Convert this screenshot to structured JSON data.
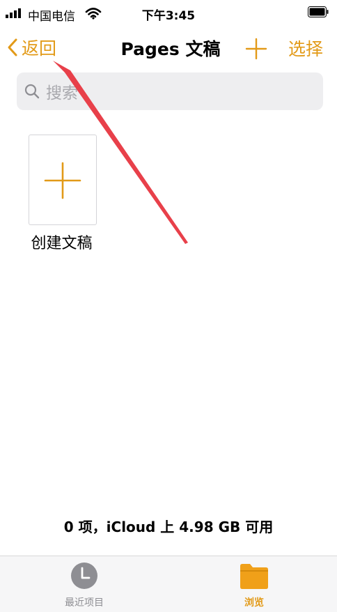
{
  "status_bar": {
    "carrier": "中国电信",
    "time": "下午3:45"
  },
  "nav": {
    "back_label": "返回",
    "title": "Pages 文稿",
    "select_label": "选择"
  },
  "search": {
    "placeholder": "搜索"
  },
  "documents": [
    {
      "label": "创建文稿"
    }
  ],
  "footer": {
    "storage_text": "0 项，iCloud 上 4.98 GB 可用"
  },
  "tab_bar": {
    "tabs": [
      {
        "label": "最近项目",
        "icon": "clock-icon",
        "active": false
      },
      {
        "label": "浏览",
        "icon": "folder-icon",
        "active": true
      }
    ]
  },
  "colors": {
    "accent": "#E29A18",
    "annotation_arrow": "#E8404A"
  }
}
